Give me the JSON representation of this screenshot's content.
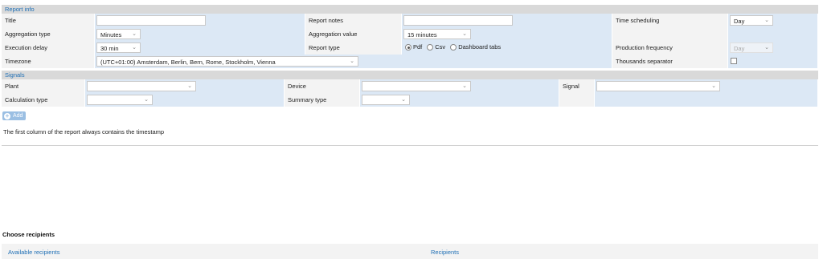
{
  "report_info": {
    "header": "Report info",
    "title_label": "Title",
    "title_value": "",
    "report_notes_label": "Report notes",
    "report_notes_value": "",
    "time_scheduling_label": "Time scheduling",
    "time_scheduling_value": "Day",
    "aggregation_type_label": "Aggregation type",
    "aggregation_type_value": "Minutes",
    "aggregation_value_label": "Aggregation value",
    "aggregation_value_value": "15 minutes",
    "execution_delay_label": "Execution delay",
    "execution_delay_value": "30 min",
    "report_type_label": "Report type",
    "report_type_options": [
      "Pdf",
      "Csv",
      "Dashboard tabs"
    ],
    "report_type_selected": "Pdf",
    "production_frequency_label": "Production frequency",
    "production_frequency_value": "Day",
    "timezone_label": "Timezone",
    "timezone_value": "(UTC+01:00) Amsterdam, Berlin, Bern, Rome, Stockholm, Vienna",
    "thousands_separator_label": "Thousands separator",
    "thousands_separator_checked": false
  },
  "signals": {
    "header": "Signals",
    "plant_label": "Plant",
    "plant_value": "",
    "device_label": "Device",
    "device_value": "",
    "signal_label": "Signal",
    "signal_value": "",
    "calculation_type_label": "Calculation type",
    "calculation_type_value": "",
    "summary_type_label": "Summary type",
    "summary_type_value": "",
    "add_button_label": "Add",
    "note": "The first column of the report always contains the timestamp"
  },
  "recipients": {
    "title": "Choose recipients",
    "available_label": "Available recipients",
    "recipients_label": "Recipients"
  },
  "colors": {
    "link_blue": "#1f6fb5",
    "value_cell_bg": "#dce8f5",
    "header_bg": "#d9d9d9",
    "add_button_bg": "#9bbfe3"
  }
}
